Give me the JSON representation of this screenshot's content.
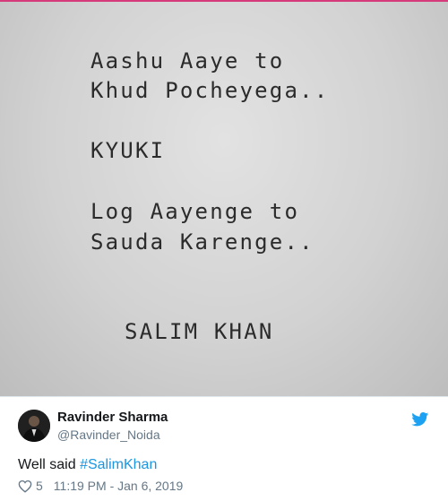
{
  "quote_image": {
    "lines": [
      "Aashu Aaye to",
      "Khud Pocheyega..",
      "KYUKI",
      "Log Aayenge to",
      "Sauda Karenge..",
      "SALIM KHAN"
    ]
  },
  "tweet": {
    "display_name": "Ravinder Sharma",
    "handle": "@Ravinder_Noida",
    "text_prefix": "Well said ",
    "hashtag": "#SalimKhan",
    "like_count": "5",
    "timestamp": "11:19 PM - Jan 6, 2019"
  },
  "icons": {
    "twitter": "twitter-bird-icon",
    "like": "heart-icon"
  },
  "colors": {
    "twitter_blue": "#1da1f2",
    "hashtag": "#1b95e0",
    "accent_top": "#d63a7a"
  }
}
